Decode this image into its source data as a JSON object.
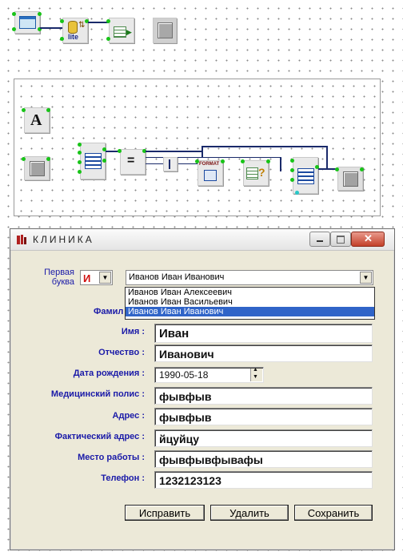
{
  "window": {
    "title": "КЛИНИКА",
    "icon": "clinic-logo-icon",
    "controls": [
      "minimize-icon",
      "maximize-icon",
      "close-icon"
    ]
  },
  "form": {
    "first_letter_label": "Первая буква",
    "first_letter_value": "И",
    "name_combo_value": "Иванов Иван Иванович",
    "name_options": [
      "Иванов Иван Алексеевич",
      "Иванов Иван Васильевич",
      "Иванов Иван Иванович"
    ],
    "selected_option_index": 2,
    "surname_label_partial": "Фамил",
    "fields": [
      {
        "key": "name",
        "label": "Имя :",
        "value": "Иван"
      },
      {
        "key": "patronymic",
        "label": "Отчество :",
        "value": "Иванович"
      },
      {
        "key": "birthdate",
        "label": "Дата рождения :",
        "value": "1990-05-18"
      },
      {
        "key": "policy",
        "label": "Медицинский полис :",
        "value": "фывфыв"
      },
      {
        "key": "address",
        "label": "Адрес :",
        "value": "фывфыв"
      },
      {
        "key": "actual_address",
        "label": "Фактический адрес :",
        "value": "йцуйцу"
      },
      {
        "key": "workplace",
        "label": "Место работы :",
        "value": "фывфывфывафы"
      },
      {
        "key": "phone",
        "label": "Телефон :",
        "value": "1232123123"
      }
    ],
    "buttons": {
      "edit": "Исправить",
      "delete": "Удалить",
      "save": "Сохранить"
    }
  },
  "scheme": {
    "db_block_label": "lite",
    "text_block_label": "A",
    "equals_label": "=",
    "format_label": "FORMAT",
    "query_label": "?"
  },
  "colors": {
    "label_blue": "#1a1aa8",
    "selection": "#3064c8",
    "pin_green": "#18c418",
    "wire": "#1a2a6a"
  }
}
